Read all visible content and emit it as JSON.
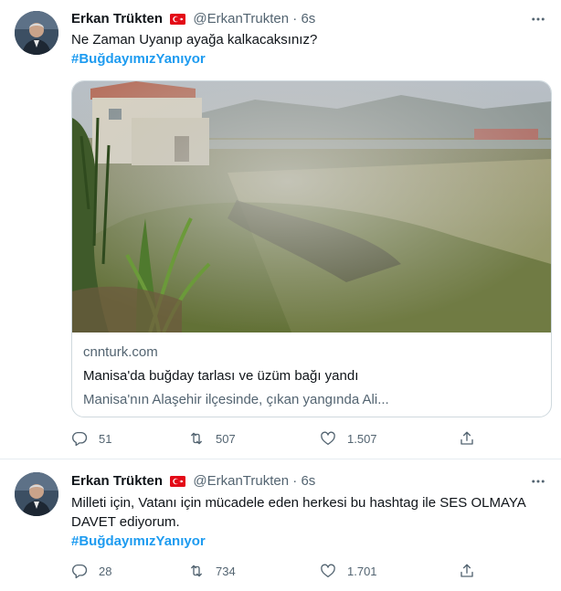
{
  "tweets": [
    {
      "author_name": "Erkan Trükten",
      "handle": "@ErkanTrukten",
      "separator": "·",
      "time": "6s",
      "text": "Ne Zaman Uyanıp ayağa kalkacaksınız?",
      "hashtag": "#BuğdayımızYanıyor",
      "card": {
        "domain": "cnnturk.com",
        "title": "Manisa'da buğday tarlası ve üzüm bağı yandı",
        "description": "Manisa'nın Alaşehir ilçesinde, çıkan yangında Ali..."
      },
      "replies": "51",
      "retweets": "507",
      "likes": "1.507"
    },
    {
      "author_name": "Erkan Trükten",
      "handle": "@ErkanTrukten",
      "separator": "·",
      "time": "6s",
      "text": "Milleti için, Vatanı için mücadele eden herkesi bu hashtag ile SES OLMAYA DAVET ediyorum.",
      "hashtag": "#BuğdayımızYanıyor",
      "replies": "28",
      "retweets": "734",
      "likes": "1.701"
    }
  ],
  "icons": {
    "reply": "reply-icon",
    "retweet": "retweet-icon",
    "like": "heart-icon",
    "share": "share-icon",
    "more": "more-icon",
    "flag": "turkey-flag-icon"
  },
  "colors": {
    "hashtag": "#1d9bf0",
    "secondary_text": "#536471",
    "border": "#cfd9de"
  }
}
